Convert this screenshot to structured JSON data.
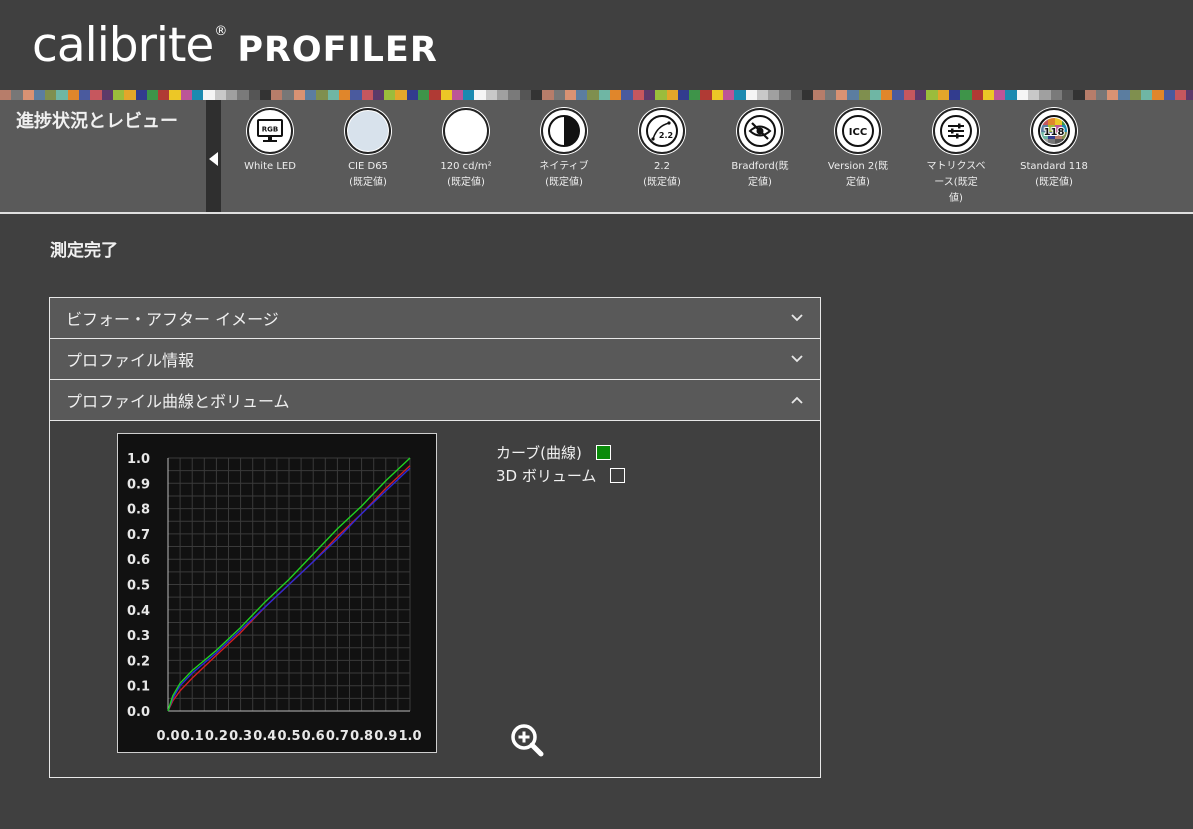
{
  "logo": {
    "brand": "calibrite",
    "reg": "®",
    "product": "PROFILER"
  },
  "swatches": [
    "#b77d6a",
    "#777777",
    "#d99273",
    "#5b7da0",
    "#7f8f4e",
    "#6fb6a4",
    "#e0862b",
    "#4a5a9e",
    "#c6575e",
    "#5c3a6a",
    "#9bbc3c",
    "#e3a62a",
    "#323c8e",
    "#3e9449",
    "#b03a34",
    "#ecc726",
    "#bc5597",
    "#1c8ab0",
    "#f5f5f5",
    "#c8c8c8",
    "#a0a0a0",
    "#7a7a7a",
    "#555555",
    "#333333"
  ],
  "progress": {
    "title": "進捗状況とレビュー",
    "steps": [
      {
        "icon": "monitor-rgb-icon",
        "label": "White LED",
        "sub": ""
      },
      {
        "icon": "whitepoint-icon",
        "label": "CIE D65",
        "sub": "(既定値)"
      },
      {
        "icon": "luminance-icon",
        "label": "120 cd/m²",
        "sub": "(既定値)"
      },
      {
        "icon": "contrast-icon",
        "label": "ネイティブ",
        "sub": "(既定値)"
      },
      {
        "icon": "gamma-curve-icon",
        "label": "2.2",
        "sub": "(既定値)"
      },
      {
        "icon": "eye-adaptation-icon",
        "label": "Bradford(既",
        "sub": "定値)"
      },
      {
        "icon": "icc-icon",
        "label": "Version 2(既",
        "sub": "定値)"
      },
      {
        "icon": "sliders-icon",
        "label": "マトリクスベ",
        "sub": "ース(既定",
        "sub2": "値)"
      },
      {
        "icon": "patch-set-icon",
        "label": "Standard 118",
        "sub": "(既定値)"
      }
    ],
    "icon_text": {
      "rgb": "RGB",
      "gamma": "2.2",
      "icc": "ICC",
      "patch": "118"
    }
  },
  "page_heading": "測定完了",
  "accordion": {
    "sections": [
      {
        "label": "ビフォー・アフター イメージ",
        "expanded": false
      },
      {
        "label": "プロファイル情報",
        "expanded": false
      },
      {
        "label": "プロファイル曲線とボリューム",
        "expanded": true
      }
    ]
  },
  "legend": {
    "curve_label": "カーブ(曲線)",
    "curve_checked": true,
    "curve_color": "#0a8a0a",
    "volume_label": "3D ボリューム",
    "volume_checked": false
  },
  "chart_data": {
    "type": "line",
    "title": "",
    "xlabel": "",
    "ylabel": "",
    "xlim": [
      0,
      1
    ],
    "ylim": [
      0,
      1
    ],
    "grid": true,
    "x_ticks": [
      "0.0",
      "0.1",
      "0.2",
      "0.3",
      "0.4",
      "0.5",
      "0.6",
      "0.7",
      "0.8",
      "0.9",
      "1.0"
    ],
    "y_ticks": [
      "0.0",
      "0.1",
      "0.2",
      "0.3",
      "0.4",
      "0.5",
      "0.6",
      "0.7",
      "0.8",
      "0.9",
      "1.0"
    ],
    "x": [
      0,
      0.02,
      0.05,
      0.1,
      0.2,
      0.3,
      0.4,
      0.5,
      0.6,
      0.7,
      0.8,
      0.9,
      1.0
    ],
    "series": [
      {
        "color": "#d02020",
        "values": [
          0,
          0.04,
          0.08,
          0.13,
          0.22,
          0.31,
          0.41,
          0.5,
          0.59,
          0.69,
          0.78,
          0.88,
          0.97
        ]
      },
      {
        "color": "#2a2ad8",
        "values": [
          0,
          0.05,
          0.1,
          0.15,
          0.23,
          0.32,
          0.41,
          0.5,
          0.59,
          0.68,
          0.78,
          0.87,
          0.96
        ]
      },
      {
        "color": "#20d020",
        "values": [
          0,
          0.06,
          0.11,
          0.16,
          0.24,
          0.33,
          0.43,
          0.52,
          0.62,
          0.72,
          0.81,
          0.91,
          1.0
        ]
      }
    ]
  }
}
